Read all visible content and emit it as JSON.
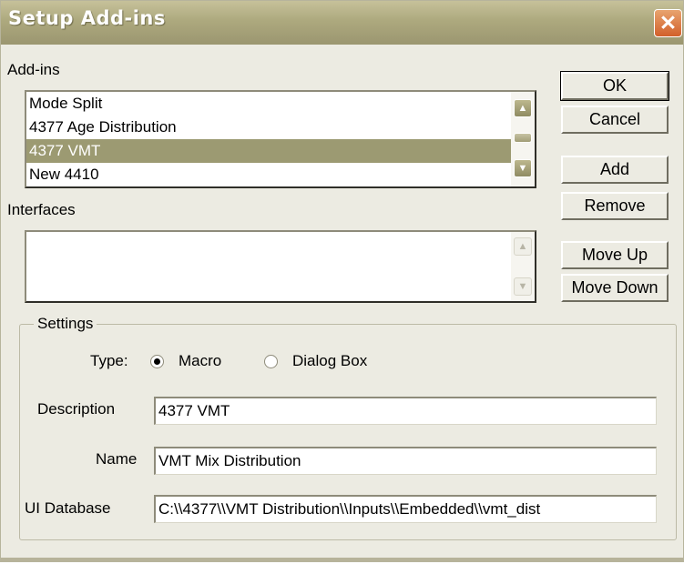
{
  "window": {
    "title": "Setup Add-ins",
    "close_glyph": "✕"
  },
  "addins": {
    "label": "Add-ins",
    "items": [
      {
        "label": "Mode Split",
        "selected": false
      },
      {
        "label": "4377 Age Distribution",
        "selected": false
      },
      {
        "label": "4377 VMT",
        "selected": true
      },
      {
        "label": "New 4410",
        "selected": false
      }
    ]
  },
  "interfaces": {
    "label": "Interfaces",
    "items": []
  },
  "buttons": {
    "ok": "OK",
    "cancel": "Cancel",
    "add": "Add",
    "remove": "Remove",
    "move_up": "Move Up",
    "move_down": "Move Down"
  },
  "settings": {
    "title": "Settings",
    "type_label": "Type:",
    "type_options": [
      {
        "label": "Macro",
        "checked": true
      },
      {
        "label": "Dialog Box",
        "checked": false
      }
    ],
    "description_label": "Description",
    "description_value": "4377 VMT",
    "name_label": "Name",
    "name_value": "VMT Mix Distribution",
    "ui_database_label": "UI Database",
    "ui_database_value": "C:\\\\4377\\\\VMT Distribution\\\\Inputs\\\\Embedded\\\\vmt_dist"
  },
  "icons": {
    "scroll_up": "scroll-up-icon",
    "scroll_down": "scroll-down-icon",
    "close": "close-icon"
  },
  "colors": {
    "titlebar": "#ada97e",
    "selection": "#9c9a72",
    "dialog_bg": "#ecebe2",
    "close_button": "#d2602b"
  }
}
